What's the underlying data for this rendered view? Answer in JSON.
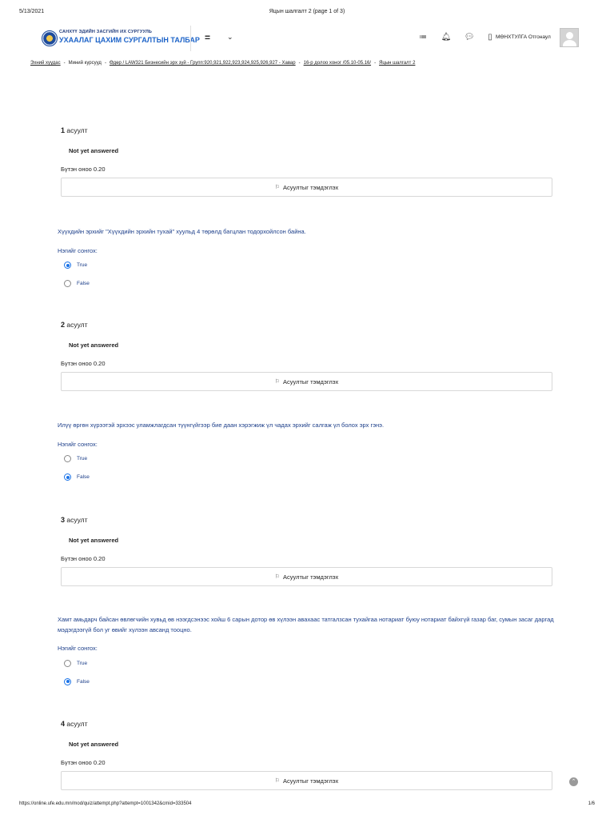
{
  "print_header": {
    "date": "5/13/2021",
    "title": "Яцын шалгалт 2 (page 1 of 3)"
  },
  "navbar": {
    "brand_small": "САНХҮҮ ЭДИЙН ЗАСГИЙН ИХ СУРГУУЛЬ",
    "brand_big": "УХААЛАГ ЦАХИМ СУРГАЛТЫН ТАЛБАР",
    "menu_glyph": "=",
    "chevron_glyph": "⌄",
    "icons": {
      "list": "≔",
      "bell": "🔔︎",
      "chat": "💬︎",
      "device": "▯"
    },
    "user_name": "МӨНХТУЛГА Отгонаул"
  },
  "breadcrumb": [
    {
      "label": "Эхний хуудас",
      "link": true
    },
    {
      "label": "Миний курсууд",
      "link": false
    },
    {
      "label": "Өдөр / LAW321 Бизнесийн эрх зүй - Групп:920,921,922,923,924,925,926,927 - Хавар",
      "link": true
    },
    {
      "label": "16-р долоо хоног /05.10-05.16/",
      "link": true
    },
    {
      "label": "Яцын шалгалт 2",
      "link": true
    }
  ],
  "breadcrumb_separator": "-",
  "question_label": "асуулт",
  "flag_label": "Асуултыг тэмдэглэх",
  "flag_glyph": "⚐",
  "prompt": "Нэгийг сонгох:",
  "questions": [
    {
      "number": "1",
      "status": "Not yet answered",
      "points": "Бүтэн оноо 0.20",
      "text": "Хүүхдийн эрхийг \"Хүүхдийн эрхийн тухай\" хуульд  4 төрөлд багцлан тодорхойлсон байна.",
      "options": [
        {
          "label": "True",
          "checked": true
        },
        {
          "label": "False",
          "checked": false
        }
      ]
    },
    {
      "number": "2",
      "status": "Not yet answered",
      "points": "Бүтэн оноо 0.20",
      "text": "Илүү өргөн хүрээтэй эрхээс уламжлагдсан түүнгүйгээр бие даан хэрэгжиж үл чадах эрхийг салгаж үл болох эрх гэнэ.",
      "options": [
        {
          "label": "True",
          "checked": false
        },
        {
          "label": "False",
          "checked": true
        }
      ]
    },
    {
      "number": "3",
      "status": "Not yet answered",
      "points": "Бүтэн оноо 0.20",
      "text": "Хамт амьдарч байсан өвлөгчийн хувьд өв нээгдсэнээс хойш 6 сарын дотор өв хүлээн авахаас татгалзсан тухайгаа нотариат буюу нотариат  байхгүй газар баг, сумын засаг даргад мэдэгдээгүй бол уг өвийг хүлээн авсанд тооцно.",
      "options": [
        {
          "label": "True",
          "checked": false
        },
        {
          "label": "False",
          "checked": true
        }
      ]
    },
    {
      "number": "4",
      "status": "Not yet answered",
      "points": "Бүтэн оноо 0.20"
    }
  ],
  "scroll_top_glyph": "⌃",
  "footer": {
    "url": "https://online.ufe.edu.mn/mod/quiz/attempt.php?attempt=1001342&cmid=333504",
    "page": "1/6"
  }
}
